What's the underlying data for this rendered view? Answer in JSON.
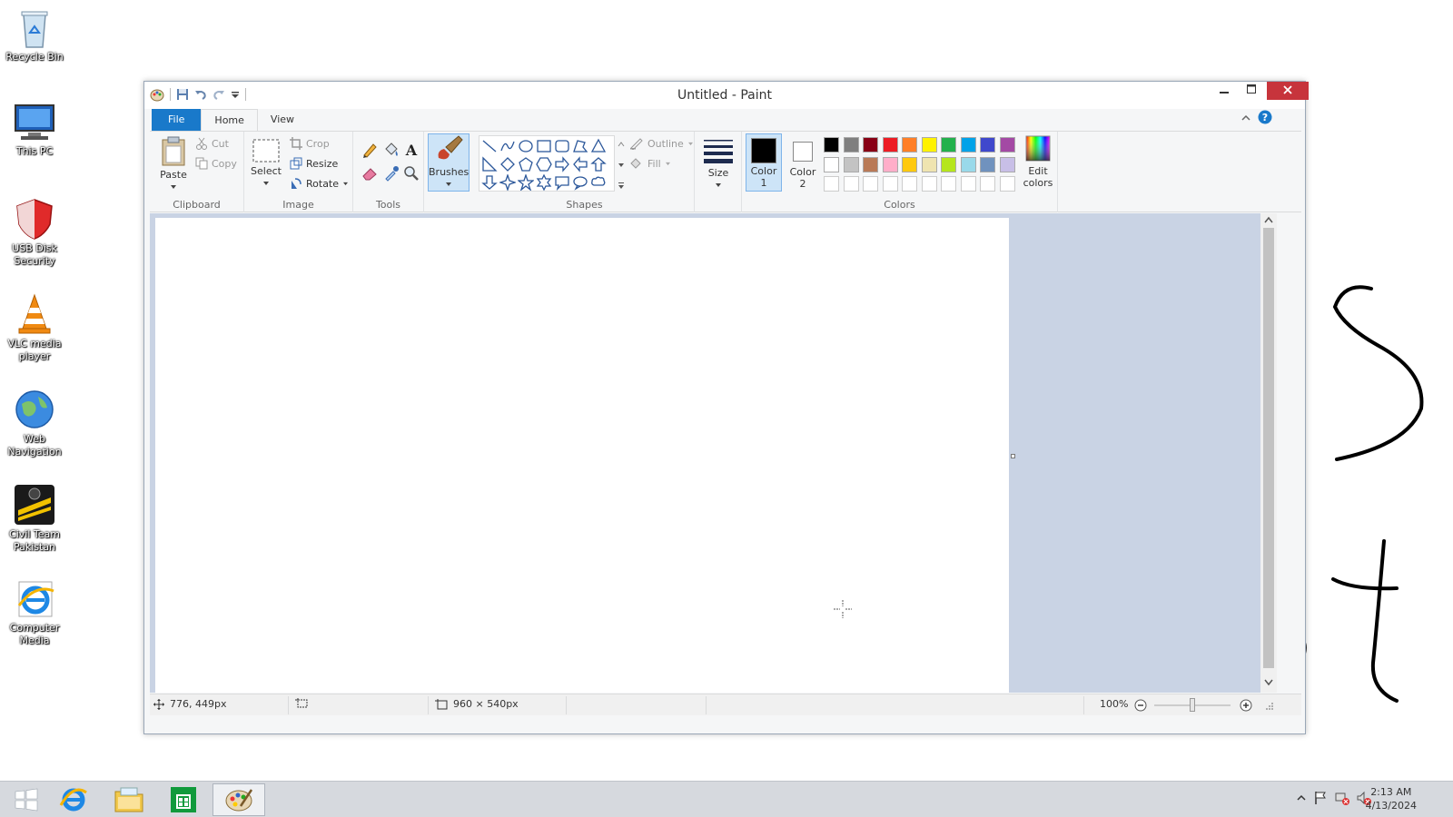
{
  "desktop": {
    "icons": [
      {
        "label": "Recycle Bin"
      },
      {
        "label": "This PC"
      },
      {
        "label": "USB Disk Security"
      },
      {
        "label": "VLC media player"
      },
      {
        "label": "Web Navigation"
      },
      {
        "label": "Civil Team Pakistan"
      },
      {
        "label": "Computer Media"
      }
    ]
  },
  "window": {
    "title": "Untitled - Paint",
    "tabs": {
      "file": "File",
      "home": "Home",
      "view": "View"
    },
    "clipboard": {
      "paste": "Paste",
      "cut": "Cut",
      "copy": "Copy",
      "label": "Clipboard"
    },
    "image": {
      "select": "Select",
      "crop": "Crop",
      "resize": "Resize",
      "rotate": "Rotate",
      "label": "Image"
    },
    "tools": {
      "label": "Tools"
    },
    "brushes": {
      "label": "Brushes"
    },
    "shapes": {
      "outline": "Outline",
      "fill": "Fill",
      "label": "Shapes"
    },
    "size": {
      "label": "Size"
    },
    "color1": {
      "label_a": "Color",
      "label_b": "1"
    },
    "color2": {
      "label_a": "Color",
      "label_b": "2"
    },
    "colors": {
      "label": "Colors",
      "edit_a": "Edit",
      "edit_b": "colors",
      "row1": [
        "#000000",
        "#7f7f7f",
        "#880015",
        "#ed1c24",
        "#ff7f27",
        "#fff200",
        "#22b14c",
        "#00a2e8",
        "#3f48cc",
        "#a349a4"
      ],
      "row2": [
        "#ffffff",
        "#c3c3c3",
        "#b97a57",
        "#ffaec9",
        "#ffc90e",
        "#efe4b0",
        "#b5e61d",
        "#99d9ea",
        "#7092be",
        "#c8bfe7"
      ]
    },
    "status": {
      "cursor_pos": "776, 449px",
      "image_size": "960 × 540px",
      "zoom": "100%"
    }
  },
  "taskbar": {
    "time": "2:13 AM",
    "date": "4/13/2024"
  }
}
